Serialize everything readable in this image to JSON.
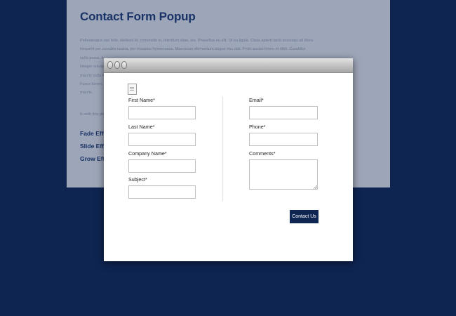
{
  "page": {
    "title": "Contact Form Popup",
    "body_lines": [
      "Pellentesque nisi felis, eleifend id, commodo in, interdum vitae, leo. Phasellus eu elit. Ut eu ligula. Class aptent taciti sociosqu ad litora",
      "torquent per conubia nostra, per inceptos hymenaeos. Maecenas elementum augue nec nisi. Proin auctor lorem et nibh. Curabitur",
      "nulla purus, fe",
      "Integer volutpat",
      "mauris nulla fe",
      "Fusce lorem. P",
      "mauris."
    ],
    "note": "In with this ple",
    "effects": [
      "Fade Effect",
      "Slide Effect",
      "Grow Effect"
    ]
  },
  "popup": {
    "fields_left": [
      {
        "label": "First Name*",
        "value": ""
      },
      {
        "label": "Last Name*",
        "value": ""
      },
      {
        "label": "Company Name*",
        "value": ""
      },
      {
        "label": "Subject*",
        "value": ""
      }
    ],
    "fields_right": [
      {
        "label": "Email*",
        "value": ""
      },
      {
        "label": "Phone*",
        "value": ""
      }
    ],
    "comments": {
      "label": "Comments*",
      "value": ""
    },
    "submit_label": "Contact Us"
  },
  "colors": {
    "backdrop": "#0e2451",
    "page": "#9da5b8",
    "heading": "#1a3366",
    "button": "#0f2552"
  },
  "icons": [
    "window-button-icon",
    "form-icon",
    "resize-grip-icon"
  ]
}
